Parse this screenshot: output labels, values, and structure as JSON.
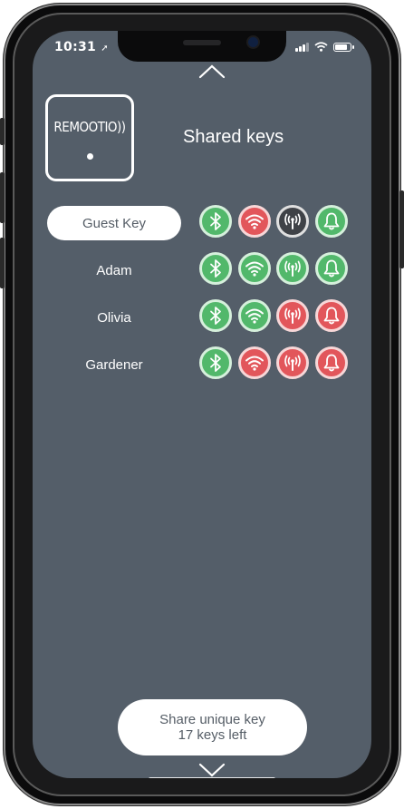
{
  "status_bar": {
    "time": "10:31"
  },
  "logo": {
    "text": "REMOOTIO))"
  },
  "page": {
    "title": "Shared keys"
  },
  "keys": [
    {
      "name": "Guest Key",
      "selected": true,
      "bluetooth": "green",
      "wifi": "red",
      "radio": "gray",
      "bell": "green"
    },
    {
      "name": "Adam",
      "selected": false,
      "bluetooth": "green",
      "wifi": "green",
      "radio": "green",
      "bell": "green"
    },
    {
      "name": "Olivia",
      "selected": false,
      "bluetooth": "green",
      "wifi": "green",
      "radio": "red",
      "bell": "red"
    },
    {
      "name": "Gardener",
      "selected": false,
      "bluetooth": "green",
      "wifi": "red",
      "radio": "red",
      "bell": "red"
    }
  ],
  "share_button": {
    "line1": "Share unique key",
    "line2": "17 keys left"
  },
  "colors": {
    "background": "#545e69",
    "green": "#52b86b",
    "red": "#e2565b",
    "gray": "#3f4247"
  }
}
